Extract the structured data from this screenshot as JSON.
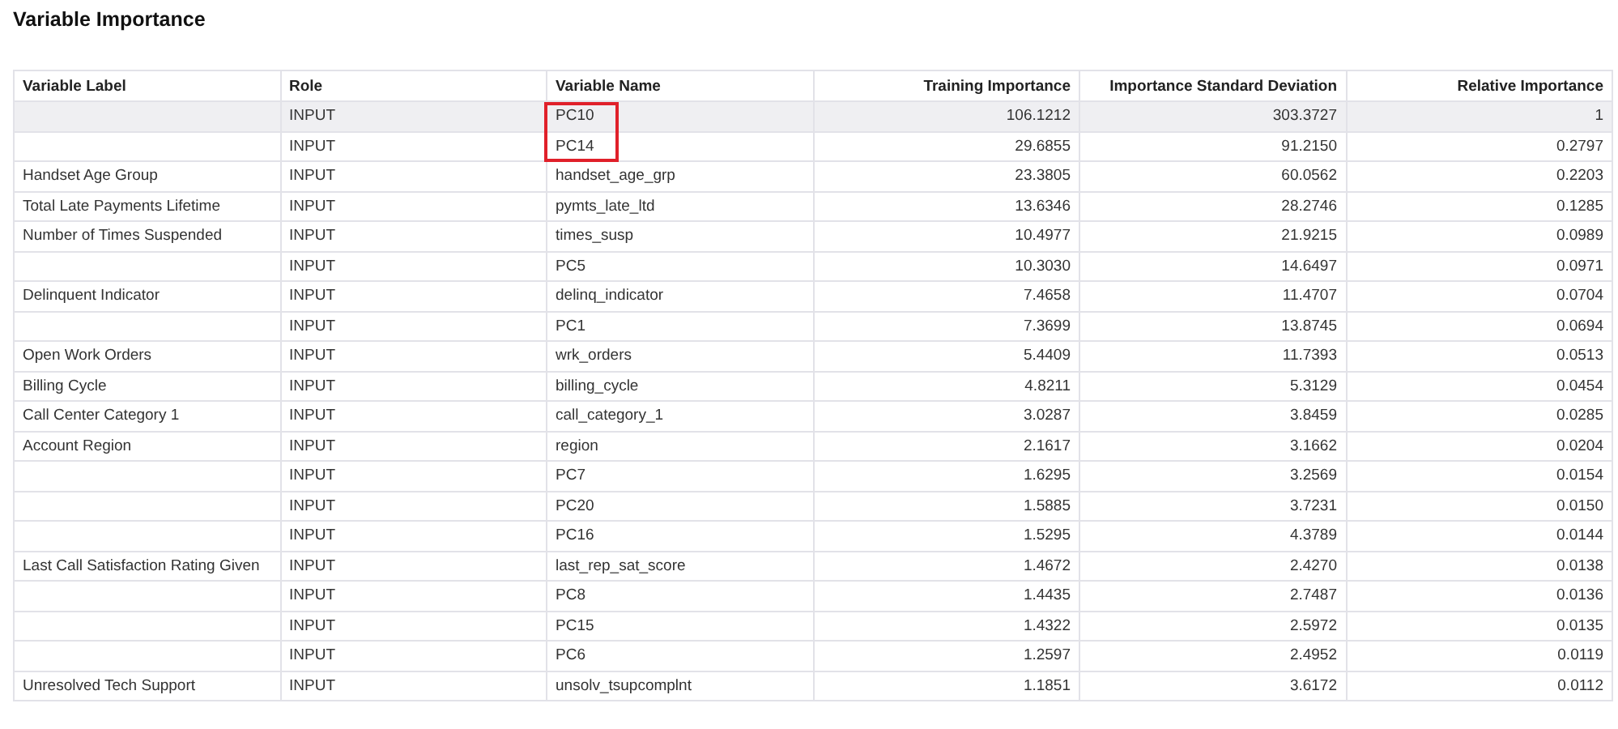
{
  "title": "Variable Importance",
  "table": {
    "columns": [
      {
        "label": "Variable Label",
        "kind": "text"
      },
      {
        "label": "Role",
        "kind": "text"
      },
      {
        "label": "Variable Name",
        "kind": "text"
      },
      {
        "label": "Training Importance",
        "kind": "number"
      },
      {
        "label": "Importance Standard Deviation",
        "kind": "number"
      },
      {
        "label": "Relative Importance",
        "kind": "number"
      }
    ],
    "rows": [
      {
        "cells": [
          "",
          "INPUT",
          "PC10",
          "106.1212",
          "303.3727",
          "1"
        ],
        "selected": true,
        "outlined": true
      },
      {
        "cells": [
          "",
          "INPUT",
          "PC14",
          "29.6855",
          "91.2150",
          "0.2797"
        ],
        "selected": false,
        "outlined": true
      },
      {
        "cells": [
          "Handset Age Group",
          "INPUT",
          "handset_age_grp",
          "23.3805",
          "60.0562",
          "0.2203"
        ],
        "selected": false,
        "outlined": false
      },
      {
        "cells": [
          "Total Late Payments Lifetime",
          "INPUT",
          "pymts_late_ltd",
          "13.6346",
          "28.2746",
          "0.1285"
        ],
        "selected": false,
        "outlined": false
      },
      {
        "cells": [
          "Number of Times Suspended",
          "INPUT",
          "times_susp",
          "10.4977",
          "21.9215",
          "0.0989"
        ],
        "selected": false,
        "outlined": false
      },
      {
        "cells": [
          "",
          "INPUT",
          "PC5",
          "10.3030",
          "14.6497",
          "0.0971"
        ],
        "selected": false,
        "outlined": false
      },
      {
        "cells": [
          "Delinquent Indicator",
          "INPUT",
          "delinq_indicator",
          "7.4658",
          "11.4707",
          "0.0704"
        ],
        "selected": false,
        "outlined": false
      },
      {
        "cells": [
          "",
          "INPUT",
          "PC1",
          "7.3699",
          "13.8745",
          "0.0694"
        ],
        "selected": false,
        "outlined": false
      },
      {
        "cells": [
          "Open Work Orders",
          "INPUT",
          "wrk_orders",
          "5.4409",
          "11.7393",
          "0.0513"
        ],
        "selected": false,
        "outlined": false
      },
      {
        "cells": [
          "Billing Cycle",
          "INPUT",
          "billing_cycle",
          "4.8211",
          "5.3129",
          "0.0454"
        ],
        "selected": false,
        "outlined": false
      },
      {
        "cells": [
          "Call Center Category 1",
          "INPUT",
          "call_category_1",
          "3.0287",
          "3.8459",
          "0.0285"
        ],
        "selected": false,
        "outlined": false
      },
      {
        "cells": [
          "Account Region",
          "INPUT",
          "region",
          "2.1617",
          "3.1662",
          "0.0204"
        ],
        "selected": false,
        "outlined": false
      },
      {
        "cells": [
          "",
          "INPUT",
          "PC7",
          "1.6295",
          "3.2569",
          "0.0154"
        ],
        "selected": false,
        "outlined": false
      },
      {
        "cells": [
          "",
          "INPUT",
          "PC20",
          "1.5885",
          "3.7231",
          "0.0150"
        ],
        "selected": false,
        "outlined": false
      },
      {
        "cells": [
          "",
          "INPUT",
          "PC16",
          "1.5295",
          "4.3789",
          "0.0144"
        ],
        "selected": false,
        "outlined": false
      },
      {
        "cells": [
          "Last Call Satisfaction Rating Given",
          "INPUT",
          "last_rep_sat_score",
          "1.4672",
          "2.4270",
          "0.0138"
        ],
        "selected": false,
        "outlined": false
      },
      {
        "cells": [
          "",
          "INPUT",
          "PC8",
          "1.4435",
          "2.7487",
          "0.0136"
        ],
        "selected": false,
        "outlined": false
      },
      {
        "cells": [
          "",
          "INPUT",
          "PC15",
          "1.4322",
          "2.5972",
          "0.0135"
        ],
        "selected": false,
        "outlined": false
      },
      {
        "cells": [
          "",
          "INPUT",
          "PC6",
          "1.2597",
          "2.4952",
          "0.0119"
        ],
        "selected": false,
        "outlined": false
      },
      {
        "cells": [
          "Unresolved Tech Support",
          "INPUT",
          "unsolv_tsupcomplnt",
          "1.1851",
          "3.6172",
          "0.0112"
        ],
        "selected": false,
        "outlined": false
      }
    ]
  }
}
